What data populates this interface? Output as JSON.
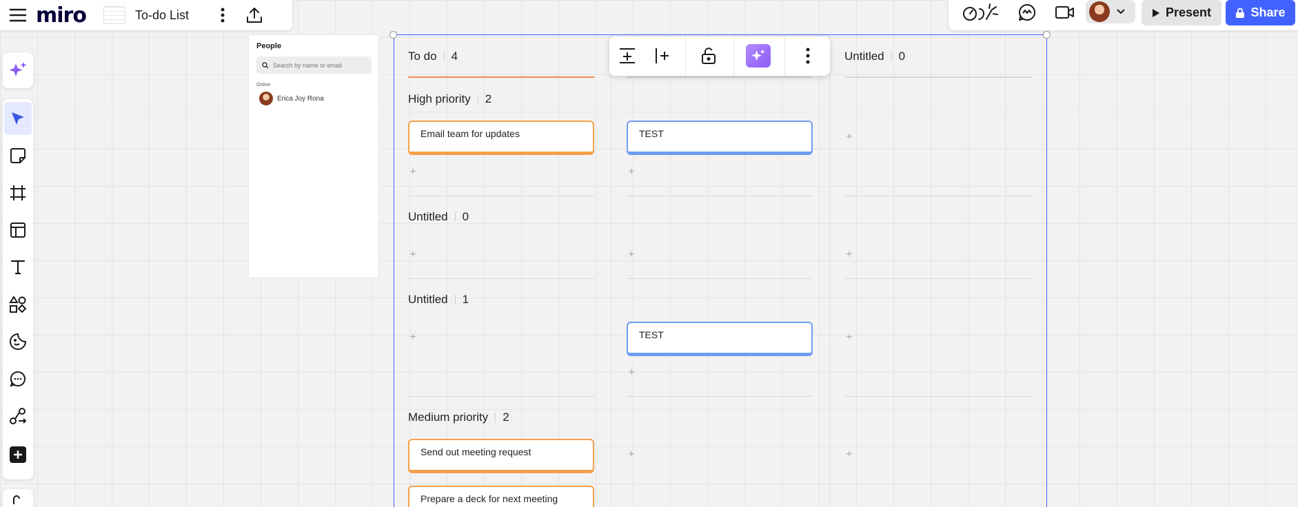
{
  "app": {
    "logo": "miro",
    "board_title": "To-do List"
  },
  "header_right": {
    "present_label": "Present",
    "share_label": "Share"
  },
  "people": {
    "title": "People",
    "search_placeholder": "Search by name or email",
    "online_label": "Online",
    "users": [
      {
        "name": "Erica Joy Rona"
      }
    ]
  },
  "kanban": {
    "columns": [
      {
        "title": "To do",
        "count": "4",
        "line_color": "#f08a4b"
      },
      {
        "title": "",
        "count": "",
        "line_color": "#d8d8d8"
      },
      {
        "title": "Untitled",
        "count": "0",
        "line_color": "#d8d8d8"
      }
    ],
    "groups": [
      {
        "title": "High priority",
        "count": "2"
      },
      {
        "title": "Untitled",
        "count": "0"
      },
      {
        "title": "Untitled",
        "count": "1"
      },
      {
        "title": "Medium priority",
        "count": "2"
      }
    ],
    "cards": {
      "email": "Email team for updates",
      "test1": "TEST",
      "test2": "TEST",
      "meeting": "Send out meeting request",
      "deck": "Prepare a deck for next meeting"
    },
    "plus_glyph": "+"
  },
  "icons": {
    "menu": "menu-icon",
    "export": "upload-icon",
    "more": "more-vertical-icon",
    "reactions": "reactions-icon",
    "activity": "activity-icon",
    "video": "video-icon",
    "present": "play-icon",
    "share": "lock-icon"
  },
  "colors": {
    "accent": "#4262ff",
    "card_orange": "#f5a04a",
    "card_blue": "#6e9dee",
    "ai_purple": "#8a5cf6"
  }
}
